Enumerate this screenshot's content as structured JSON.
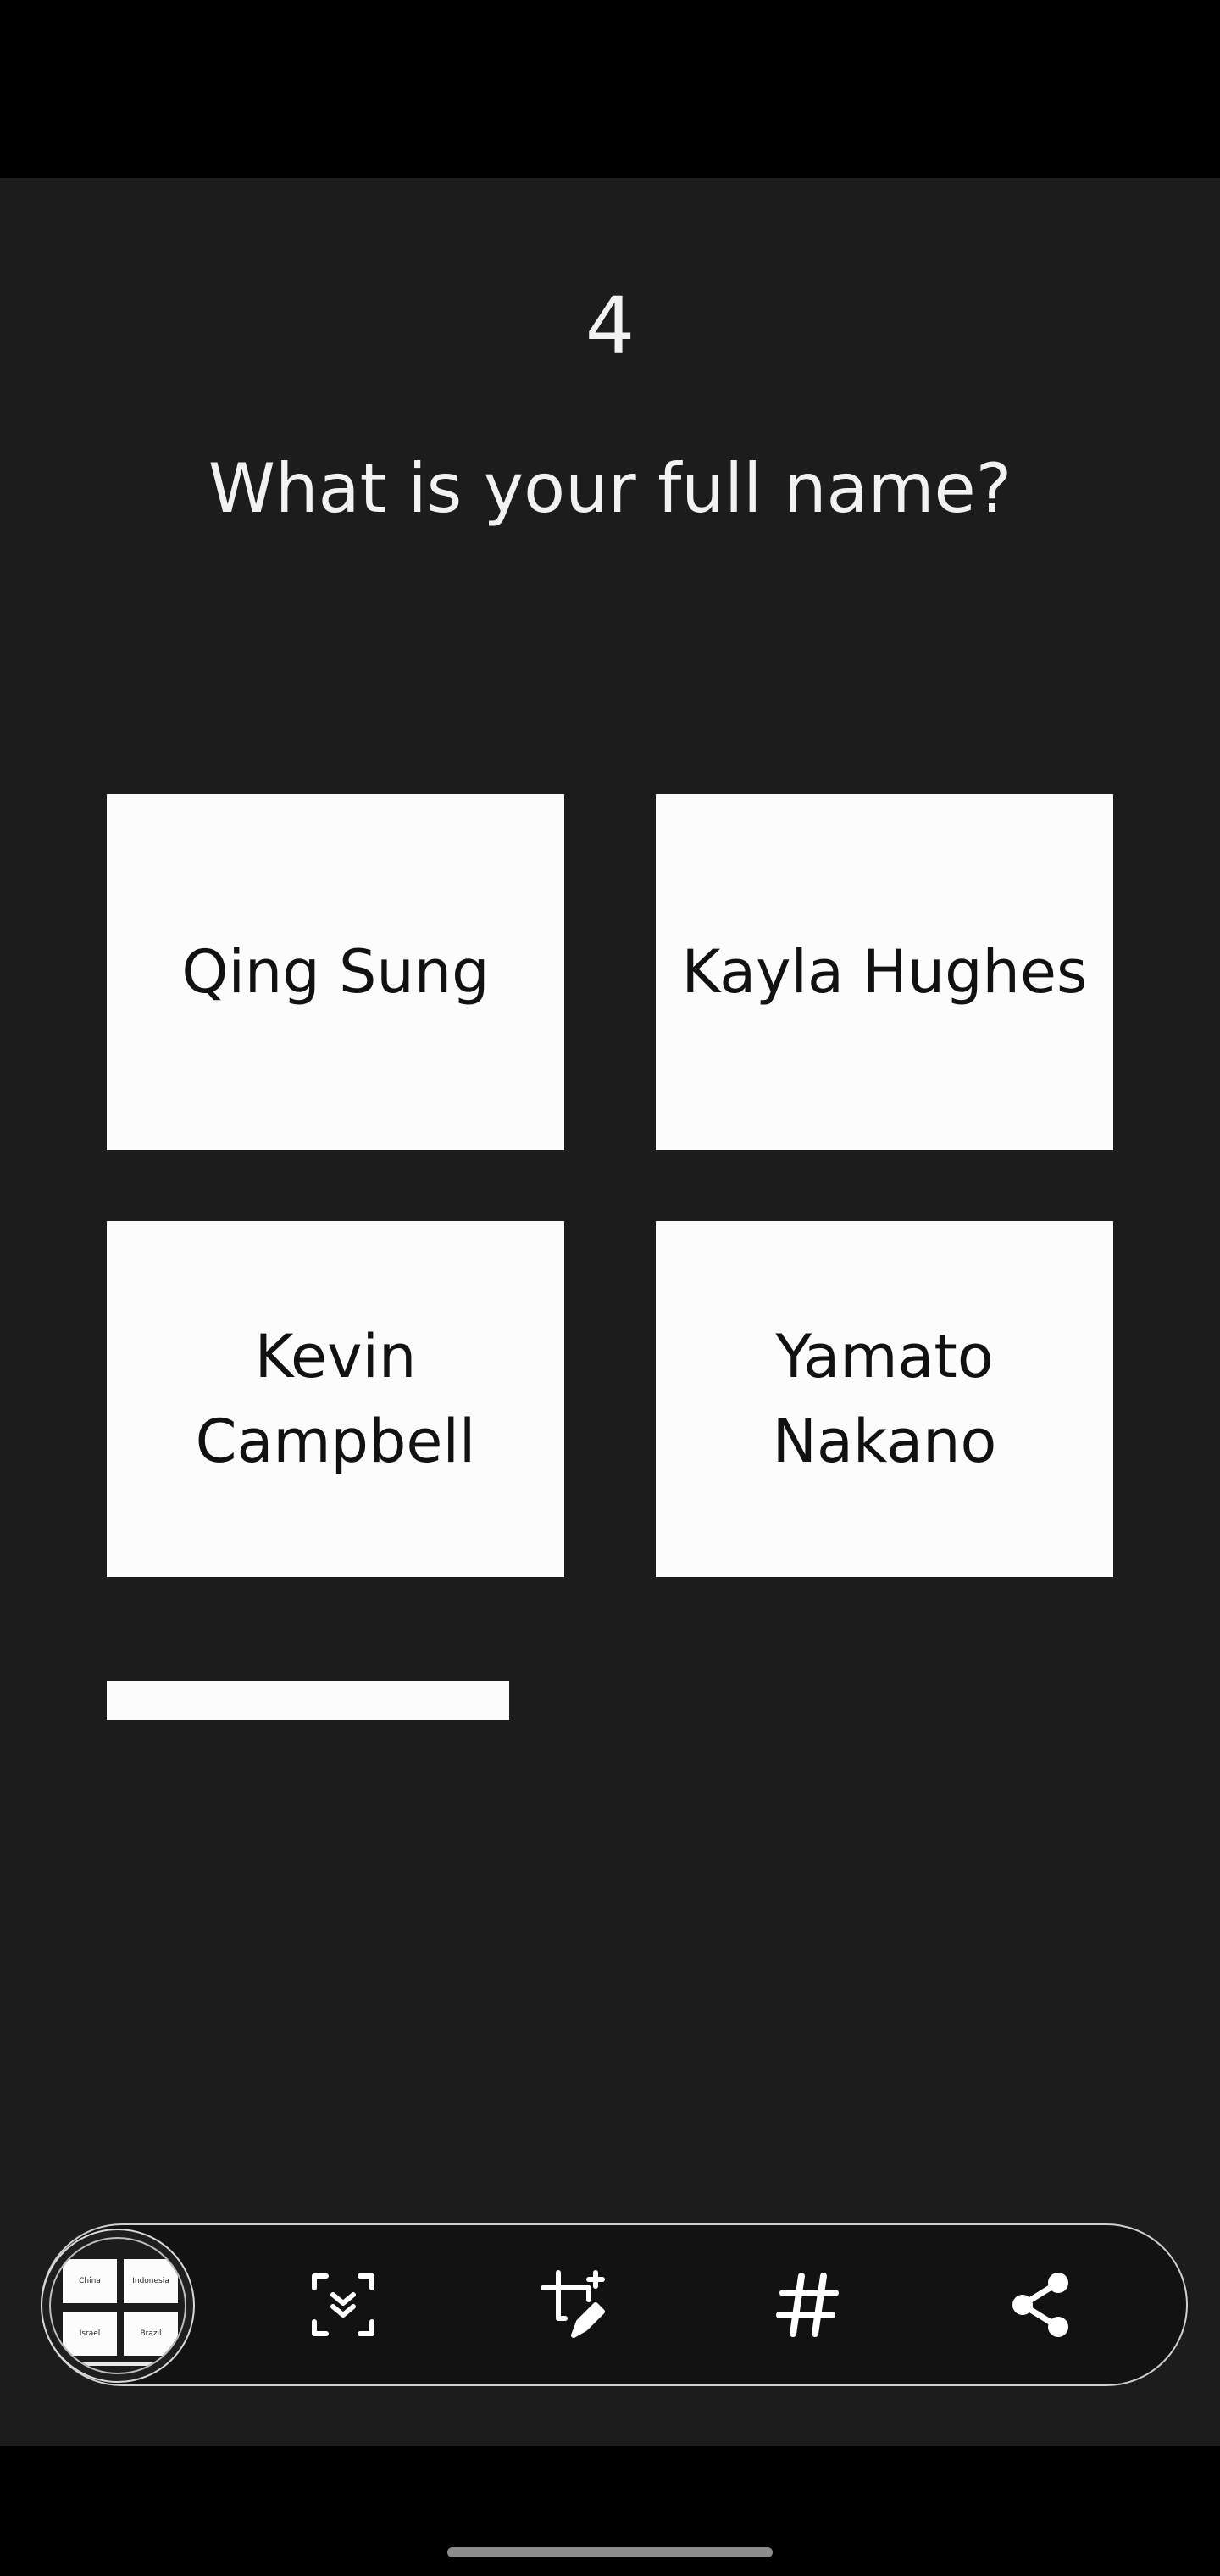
{
  "quiz": {
    "question_number": "4",
    "question_text": "What is your full name?",
    "answers": [
      {
        "label": "Qing Sung"
      },
      {
        "label": "Kayla Hughes"
      },
      {
        "label": "Kevin Campbell"
      },
      {
        "label": "Yamato Nakano"
      }
    ],
    "progress_fraction": 0.4
  },
  "toolbar": {
    "thumbnail_cards": [
      "China",
      "Indonesia",
      "Israel",
      "Brazil"
    ],
    "icons": [
      "scroll-capture-icon",
      "crop-edit-icon",
      "hashtag-icon",
      "share-icon"
    ]
  },
  "colors": {
    "background": "#1c1c1c",
    "card": "#fcfcfc",
    "text_light": "#f2f2f2",
    "text_dark": "#111111"
  }
}
